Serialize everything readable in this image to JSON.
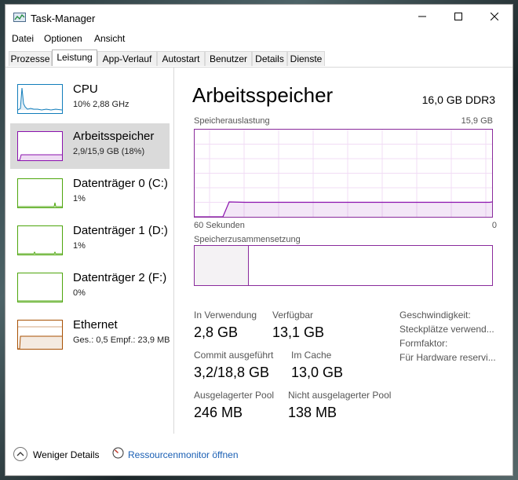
{
  "window": {
    "title": "Task-Manager"
  },
  "menu": [
    "Datei",
    "Optionen",
    "Ansicht"
  ],
  "tabs": [
    "Prozesse",
    "Leistung",
    "App-Verlauf",
    "Autostart",
    "Benutzer",
    "Details",
    "Dienste"
  ],
  "active_tab": "Leistung",
  "sidebar": {
    "items": [
      {
        "title": "CPU",
        "sub": "10%  2,88 GHz"
      },
      {
        "title": "Arbeitsspeicher",
        "sub": "2,9/15,9 GB (18%)"
      },
      {
        "title": "Datenträger 0 (C:)",
        "sub": "1%"
      },
      {
        "title": "Datenträger 1 (D:)",
        "sub": "1%"
      },
      {
        "title": "Datenträger 2 (F:)",
        "sub": "0%"
      },
      {
        "title": "Ethernet",
        "sub": "Ges.: 0,5  Empf.: 23,9 MB"
      }
    ]
  },
  "colors": {
    "cpu": "#117dbb",
    "memory": "#8b12ae",
    "disk": "#4da60c",
    "ethernet": "#a74f01",
    "link": "#1a5fb4"
  },
  "main": {
    "title": "Arbeitsspeicher",
    "spec": "16,0 GB DDR3",
    "graph": {
      "label": "Speicherauslastung",
      "max_label": "15,9 GB",
      "x_left": "60 Sekunden",
      "x_right": "0",
      "usage_fraction": 0.18
    },
    "composition": {
      "label": "Speicherzusammensetzung",
      "used_fraction": 0.18
    },
    "stats": {
      "in_use_label": "In Verwendung",
      "in_use_value": "2,8 GB",
      "available_label": "Verfügbar",
      "available_value": "13,1 GB",
      "commit_label": "Commit ausgeführt",
      "commit_value": "3,2/18,8 GB",
      "cache_label": "Im Cache",
      "cache_value": "13,0 GB",
      "paged_label": "Ausgelagerter Pool",
      "paged_value": "246 MB",
      "nonpaged_label": "Nicht ausgelagerter Pool",
      "nonpaged_value": "138 MB"
    },
    "info": [
      "Geschwindigkeit:",
      "Steckplätze verwend...",
      "Formfaktor:",
      "Für Hardware reservi..."
    ]
  },
  "footer": {
    "less_details": "Weniger Details",
    "resource_monitor": "Ressourcenmonitor öffnen"
  }
}
